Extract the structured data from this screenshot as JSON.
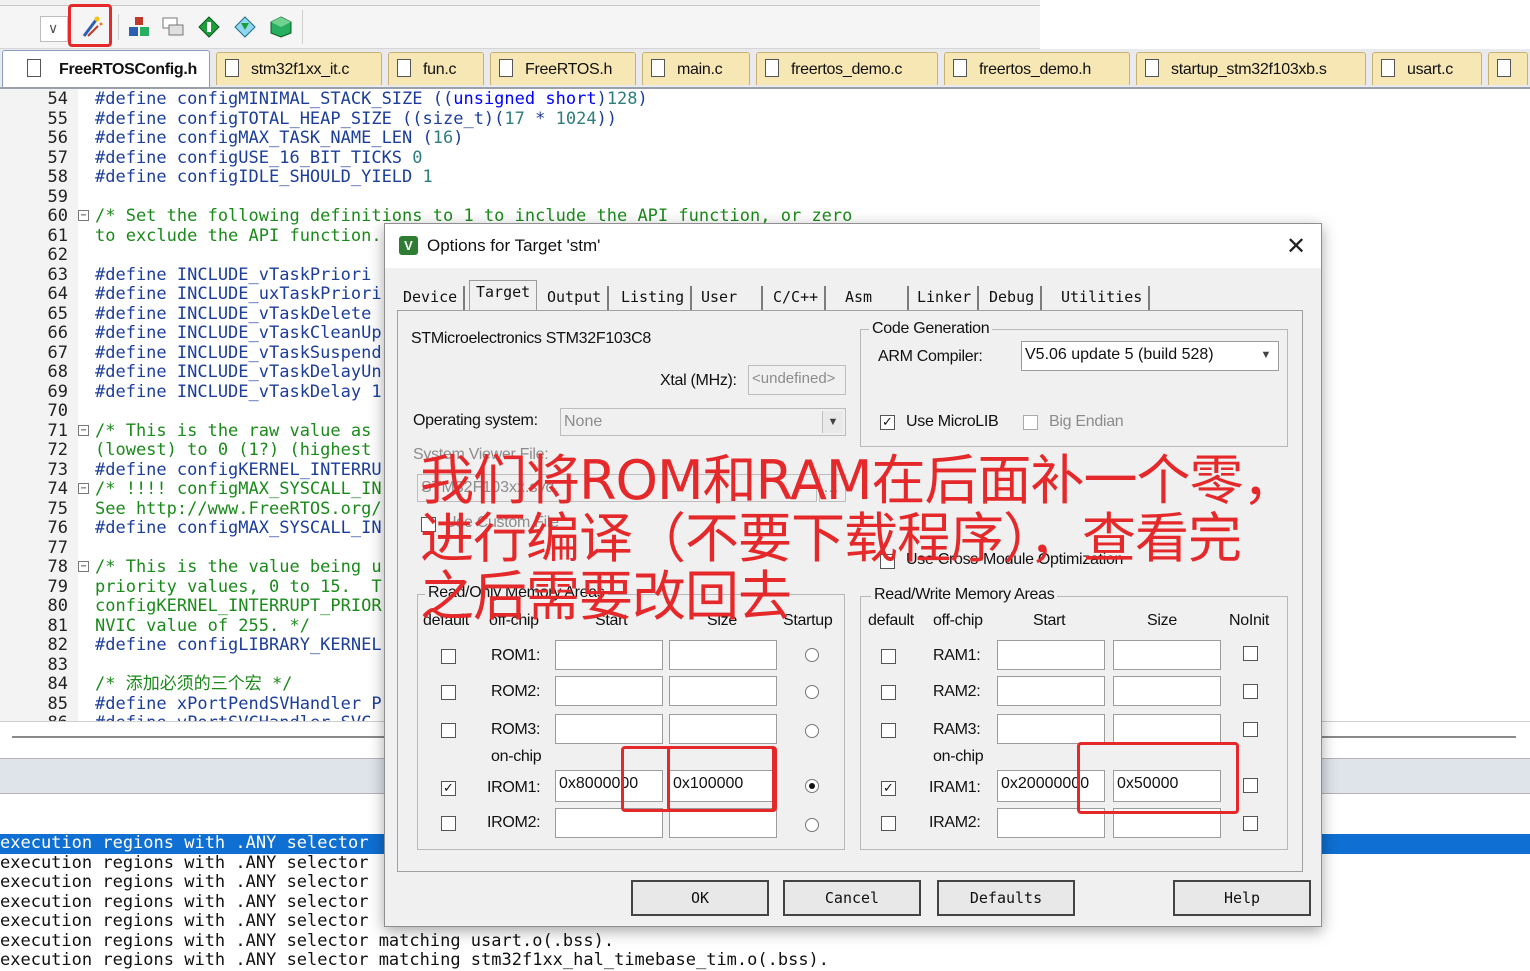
{
  "toolbar": {
    "dropdown_arrow": "∨",
    "icons": [
      "magic-wand-icon",
      "load-icon",
      "windows-icon",
      "diamond-green-icon",
      "diamond-download-icon",
      "package-icon"
    ]
  },
  "tabs": [
    {
      "label": "FreeRTOSConfig.h",
      "active": true
    },
    {
      "label": "stm32f1xx_it.c"
    },
    {
      "label": "fun.c"
    },
    {
      "label": "FreeRTOS.h"
    },
    {
      "label": "main.c"
    },
    {
      "label": "freertos_demo.c"
    },
    {
      "label": "freertos_demo.h"
    },
    {
      "label": "startup_stm32f103xb.s"
    },
    {
      "label": "usart.c"
    }
  ],
  "editor": {
    "lines": [
      {
        "n": "54",
        "t": "#define configMINIMAL_STACK_SIZE ((unsigned short)128)"
      },
      {
        "n": "55",
        "t": "#define configTOTAL_HEAP_SIZE ((size_t)(17 * 1024))"
      },
      {
        "n": "56",
        "t": "#define configMAX_TASK_NAME_LEN (16)"
      },
      {
        "n": "57",
        "t": "#define configUSE_16_BIT_TICKS 0"
      },
      {
        "n": "58",
        "t": "#define configIDLE_SHOULD_YIELD 1"
      },
      {
        "n": "59",
        "t": ""
      },
      {
        "n": "60",
        "t": "/* Set the following definitions to 1 to include the API function, or zero",
        "fold": true
      },
      {
        "n": "61",
        "t": "to exclude the API function."
      },
      {
        "n": "62",
        "t": ""
      },
      {
        "n": "63",
        "t": "#define INCLUDE_vTaskPriori"
      },
      {
        "n": "64",
        "t": "#define INCLUDE_uxTaskPriori"
      },
      {
        "n": "65",
        "t": "#define INCLUDE_vTaskDelete"
      },
      {
        "n": "66",
        "t": "#define INCLUDE_vTaskCleanUp"
      },
      {
        "n": "67",
        "t": "#define INCLUDE_vTaskSuspend"
      },
      {
        "n": "68",
        "t": "#define INCLUDE_vTaskDelayUn"
      },
      {
        "n": "69",
        "t": "#define INCLUDE_vTaskDelay 1"
      },
      {
        "n": "70",
        "t": ""
      },
      {
        "n": "71",
        "t": "/* This is the raw value as",
        "fold": true
      },
      {
        "n": "72",
        "t": "(lowest) to 0 (1?) (highest"
      },
      {
        "n": "73",
        "t": "#define configKERNEL_INTERRU"
      },
      {
        "n": "74",
        "t": "/* !!!! configMAX_SYSCALL_IN",
        "fold": true
      },
      {
        "n": "75",
        "t": "See http://www.FreeRTOS.org/"
      },
      {
        "n": "76",
        "t": "#define configMAX_SYSCALL_IN"
      },
      {
        "n": "77",
        "t": ""
      },
      {
        "n": "78",
        "t": "/* This is the value being u",
        "fold": true
      },
      {
        "n": "79",
        "t": "priority values, 0 to 15.  T"
      },
      {
        "n": "80",
        "t": "configKERNEL_INTERRUPT_PRIOR"
      },
      {
        "n": "81",
        "t": "NVIC value of 255. */"
      },
      {
        "n": "82",
        "t": "#define configLIBRARY_KERNEL"
      },
      {
        "n": "83",
        "t": ""
      },
      {
        "n": "84",
        "t": "/* 添加必须的三个宏 */"
      },
      {
        "n": "85",
        "t": "#define xPortPendSVHandler P"
      },
      {
        "n": "86",
        "t": "#define vPortSVCHandler SVC"
      }
    ]
  },
  "build": {
    "lines": [
      "execution regions with .ANY selector",
      "execution regions with .ANY selector",
      "execution regions with .ANY selector",
      "execution regions with .ANY selector",
      "execution regions with .ANY selector",
      "execution regions with .ANY selector matching usart.o(.bss).",
      "execution regions with .ANY selector matching stm32f1xx_hal_timebase_tim.o(.bss)."
    ]
  },
  "dialog": {
    "title": "Options for Target 'stm'",
    "close": "✕",
    "tabs": [
      "Device",
      "Target",
      "Output",
      "Listing",
      "User",
      "C/C++",
      "Asm",
      "Linker",
      "Debug",
      "Utilities"
    ],
    "active_tab": "Target",
    "device_name": "STMicroelectronics STM32F103C8",
    "xtal_label": "Xtal (MHz):",
    "xtal_value": "<undefined>",
    "os_label": "Operating system:",
    "os_value": "None",
    "svf_label": "System Viewer File:",
    "svf_value": "STM32F103xx.svd",
    "use_custom_file": "Use Custom File",
    "code_gen": {
      "title": "Code Generation",
      "arm_compiler_label": "ARM Compiler:",
      "arm_compiler_value": "V5.06 update 5 (build 528)",
      "use_microlib": "Use MicroLIB",
      "big_endian": "Big Endian",
      "cross_module": "Use Cross-Module Optimization"
    },
    "rom": {
      "title": "Read/Only Memory Areas",
      "headers": [
        "default",
        "off-chip",
        "Start",
        "Size",
        "Startup"
      ],
      "on_chip": "on-chip",
      "rows": [
        {
          "label": "ROM1:",
          "start": "",
          "size": ""
        },
        {
          "label": "ROM2:",
          "start": "",
          "size": ""
        },
        {
          "label": "ROM3:",
          "start": "",
          "size": ""
        },
        {
          "label": "IROM1:",
          "start": "0x8000000",
          "size": "0x100000"
        },
        {
          "label": "IROM2:",
          "start": "",
          "size": ""
        }
      ]
    },
    "ram": {
      "title": "Read/Write Memory Areas",
      "headers": [
        "default",
        "off-chip",
        "Start",
        "Size",
        "NoInit"
      ],
      "on_chip": "on-chip",
      "rows": [
        {
          "label": "RAM1:",
          "start": "",
          "size": ""
        },
        {
          "label": "RAM2:",
          "start": "",
          "size": ""
        },
        {
          "label": "RAM3:",
          "start": "",
          "size": ""
        },
        {
          "label": "IRAM1:",
          "start": "0x20000000",
          "size": "0x50000"
        },
        {
          "label": "IRAM2:",
          "start": "",
          "size": ""
        }
      ]
    },
    "buttons": {
      "ok": "OK",
      "cancel": "Cancel",
      "defaults": "Defaults",
      "help": "Help"
    }
  },
  "annotation": {
    "lines": [
      "我们将ROM和RAM在后面补一个零，",
      "进行编译（不要下载程序），查看完",
      "之后需要改回去"
    ],
    "color": "#e5282a"
  }
}
